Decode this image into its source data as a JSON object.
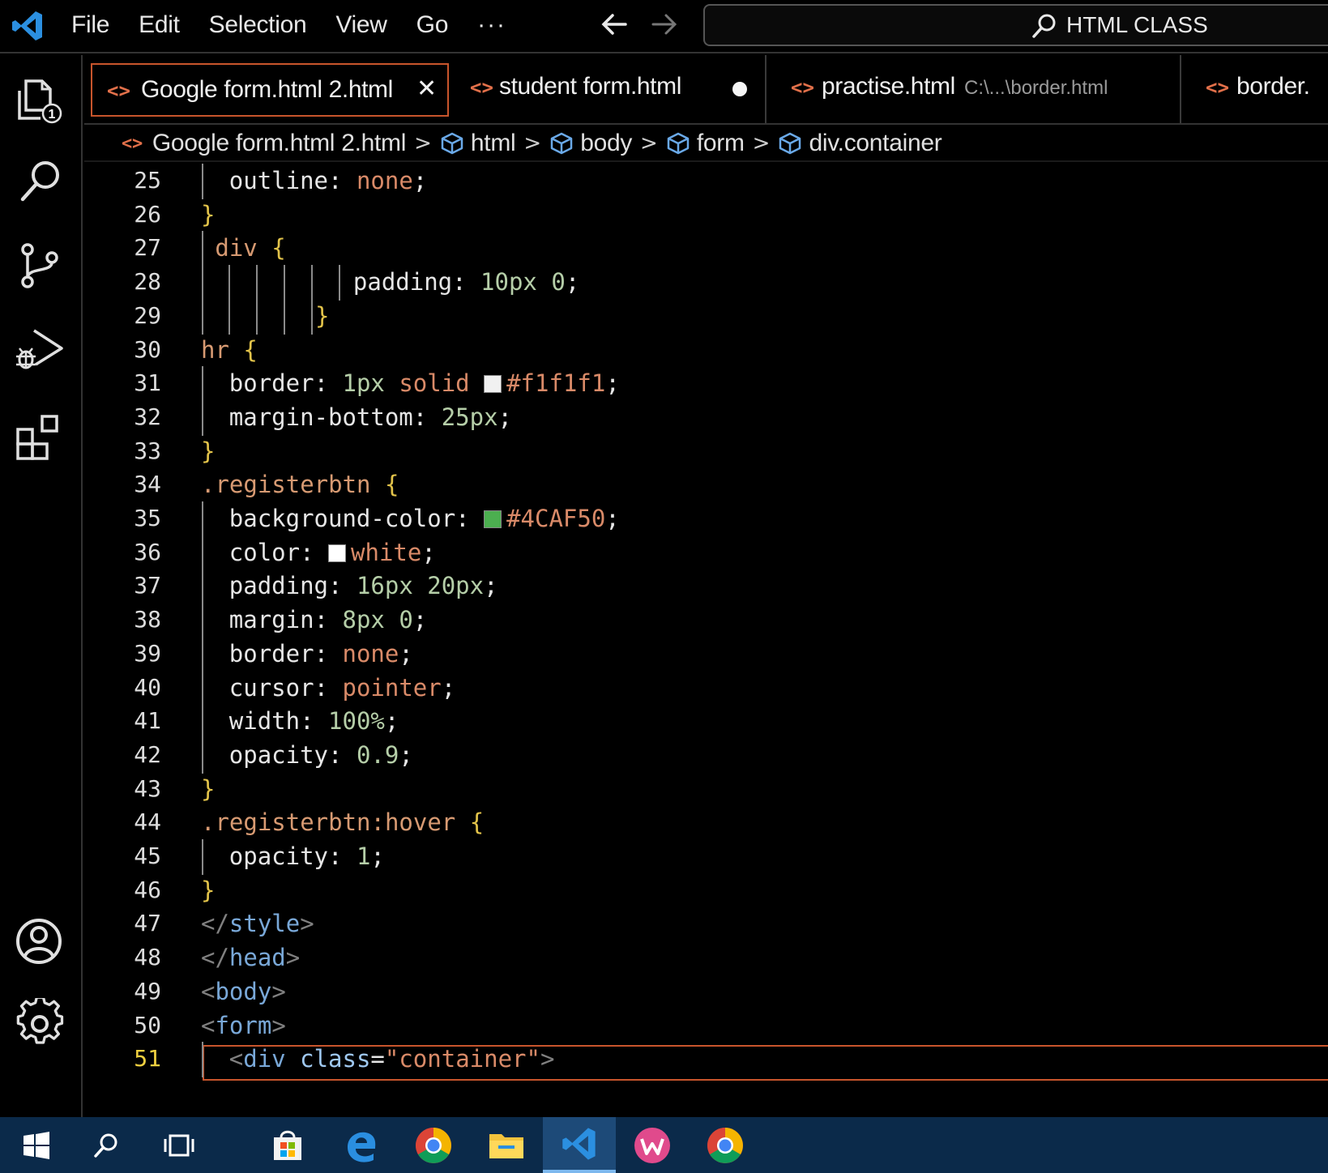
{
  "titlebar": {
    "menu": [
      "File",
      "Edit",
      "Selection",
      "View",
      "Go"
    ],
    "more_label": "···",
    "command_center_label": "HTML CLASS",
    "icons": [
      "vscode-logo-icon",
      "arrow-left-icon",
      "arrow-right-icon",
      "search-icon"
    ]
  },
  "activity_bar": {
    "items": [
      "explorer-icon",
      "search-icon",
      "source-control-icon",
      "run-debug-icon",
      "extensions-icon",
      "accounts-icon",
      "settings-gear-icon"
    ],
    "explorer_badge": "1"
  },
  "tabs": [
    {
      "label": "Google form.html 2.html",
      "active": true,
      "close": "✕"
    },
    {
      "label": "student form.html",
      "modified": true
    },
    {
      "label": "practise.html",
      "description": "C:\\...\\border.html"
    },
    {
      "label": "border."
    }
  ],
  "breadcrumb": {
    "file": "Google form.html 2.html",
    "items": [
      "html",
      "body",
      "form",
      "div.container"
    ],
    "separator": ">"
  },
  "editor": {
    "current_line": "51",
    "lines": [
      {
        "num": "25",
        "tokens": [
          [
            "outline",
            "prop"
          ],
          [
            ": ",
            "punct"
          ],
          [
            "none",
            "val"
          ],
          [
            ";",
            "punct"
          ]
        ]
      },
      {
        "num": "26",
        "tokens": [
          [
            "}",
            "brace"
          ]
        ]
      },
      {
        "num": "27",
        "tokens": [
          [
            "div ",
            "sel"
          ],
          [
            "{",
            "brace"
          ]
        ]
      },
      {
        "num": "28",
        "tokens": [
          [
            "padding",
            "prop"
          ],
          [
            ": ",
            "punct"
          ],
          [
            "10px 0",
            "num"
          ],
          [
            ";",
            "punct"
          ]
        ]
      },
      {
        "num": "29",
        "tokens": [
          [
            "}",
            "brace"
          ]
        ]
      },
      {
        "num": "30",
        "tokens": [
          [
            "hr ",
            "sel"
          ],
          [
            "{",
            "brace"
          ]
        ]
      },
      {
        "num": "31",
        "tokens": [
          [
            "border",
            "prop"
          ],
          [
            ": ",
            "punct"
          ],
          [
            "1px ",
            "num"
          ],
          [
            "solid ",
            "val"
          ],
          [
            "#f1f1f1",
            "val"
          ],
          [
            ";",
            "punct"
          ]
        ]
      },
      {
        "num": "32",
        "tokens": [
          [
            "margin-bottom",
            "prop"
          ],
          [
            ": ",
            "punct"
          ],
          [
            "25px",
            "num"
          ],
          [
            ";",
            "punct"
          ]
        ]
      },
      {
        "num": "33",
        "tokens": [
          [
            "}",
            "brace"
          ]
        ]
      },
      {
        "num": "34",
        "tokens": [
          [
            ".registerbtn ",
            "sel"
          ],
          [
            "{",
            "brace"
          ]
        ]
      },
      {
        "num": "35",
        "tokens": [
          [
            "background-color",
            "prop"
          ],
          [
            ": ",
            "punct"
          ],
          [
            "#4CAF50",
            "val"
          ],
          [
            ";",
            "punct"
          ]
        ]
      },
      {
        "num": "36",
        "tokens": [
          [
            "color",
            "prop"
          ],
          [
            ": ",
            "punct"
          ],
          [
            "white",
            "val"
          ],
          [
            ";",
            "punct"
          ]
        ]
      },
      {
        "num": "37",
        "tokens": [
          [
            "padding",
            "prop"
          ],
          [
            ": ",
            "punct"
          ],
          [
            "16px 20px",
            "num"
          ],
          [
            ";",
            "punct"
          ]
        ]
      },
      {
        "num": "38",
        "tokens": [
          [
            "margin",
            "prop"
          ],
          [
            ": ",
            "punct"
          ],
          [
            "8px 0",
            "num"
          ],
          [
            ";",
            "punct"
          ]
        ]
      },
      {
        "num": "39",
        "tokens": [
          [
            "border",
            "prop"
          ],
          [
            ": ",
            "punct"
          ],
          [
            "none",
            "val"
          ],
          [
            ";",
            "punct"
          ]
        ]
      },
      {
        "num": "40",
        "tokens": [
          [
            "cursor",
            "prop"
          ],
          [
            ": ",
            "punct"
          ],
          [
            "pointer",
            "val"
          ],
          [
            ";",
            "punct"
          ]
        ]
      },
      {
        "num": "41",
        "tokens": [
          [
            "width",
            "prop"
          ],
          [
            ": ",
            "punct"
          ],
          [
            "100%",
            "num"
          ],
          [
            ";",
            "punct"
          ]
        ]
      },
      {
        "num": "42",
        "tokens": [
          [
            "opacity",
            "prop"
          ],
          [
            ": ",
            "punct"
          ],
          [
            "0.9",
            "num"
          ],
          [
            ";",
            "punct"
          ]
        ]
      },
      {
        "num": "43",
        "tokens": [
          [
            "}",
            "brace"
          ]
        ]
      },
      {
        "num": "44",
        "tokens": [
          [
            ".registerbtn:hover ",
            "sel"
          ],
          [
            "{",
            "brace"
          ]
        ]
      },
      {
        "num": "45",
        "tokens": [
          [
            "opacity",
            "prop"
          ],
          [
            ": ",
            "punct"
          ],
          [
            "1",
            "num"
          ],
          [
            ";",
            "punct"
          ]
        ]
      },
      {
        "num": "46",
        "tokens": [
          [
            "}",
            "brace"
          ]
        ]
      },
      {
        "num": "47",
        "tokens": [
          [
            "</",
            "bracket"
          ],
          [
            "style",
            "tag"
          ],
          [
            ">",
            "bracket"
          ]
        ]
      },
      {
        "num": "48",
        "tokens": [
          [
            "</",
            "bracket"
          ],
          [
            "head",
            "tag"
          ],
          [
            ">",
            "bracket"
          ]
        ]
      },
      {
        "num": "49",
        "tokens": [
          [
            "<",
            "bracket"
          ],
          [
            "body",
            "tag"
          ],
          [
            ">",
            "bracket"
          ]
        ]
      },
      {
        "num": "50",
        "tokens": [
          [
            "<",
            "bracket"
          ],
          [
            "form",
            "tag"
          ],
          [
            ">",
            "bracket"
          ]
        ]
      },
      {
        "num": "51",
        "tokens": [
          [
            "<",
            "bracket"
          ],
          [
            "div ",
            "tag"
          ],
          [
            "class",
            "attr"
          ],
          [
            "=",
            "punct"
          ],
          [
            "\"container\"",
            "str"
          ],
          [
            ">",
            "bracket"
          ]
        ]
      }
    ]
  },
  "colors": {
    "accent": "#c8552c",
    "swatch_f1f1f1": "#f1f1f1",
    "swatch_4caf50": "#4CAF50",
    "swatch_white": "#ffffff",
    "taskbar": "#0b2a4a"
  },
  "taskbar": {
    "items": [
      "windows-start-icon",
      "search-icon",
      "task-view-icon",
      "microsoft-store-icon",
      "edge-legacy-icon",
      "chrome-icon",
      "file-explorer-icon",
      "vscode-icon",
      "wps-office-icon",
      "chrome-icon"
    ]
  }
}
